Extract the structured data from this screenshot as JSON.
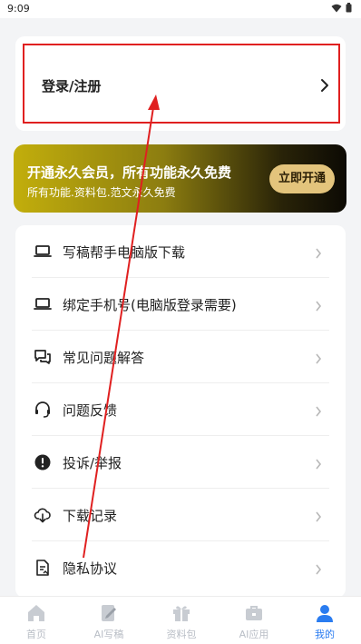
{
  "status_bar": {
    "time": "9:09",
    "icons": [
      "wifi-icon",
      "battery-icon"
    ]
  },
  "login": {
    "label": "登录/注册"
  },
  "vip": {
    "title": "开通永久会员，所有功能永久免费",
    "subtitle": "所有功能.资料包.范文永久免费",
    "button_label": "立即开通"
  },
  "menu": {
    "items": [
      {
        "label": "写稿帮手电脑版下载",
        "icon": "laptop-icon"
      },
      {
        "label": "绑定手机号(电脑版登录需要)",
        "icon": "laptop-icon"
      },
      {
        "label": "常见问题解答",
        "icon": "chat-bubbles-icon"
      },
      {
        "label": "问题反馈",
        "icon": "headset-icon"
      },
      {
        "label": "投诉/举报",
        "icon": "alert-icon"
      },
      {
        "label": "下载记录",
        "icon": "cloud-download-icon"
      },
      {
        "label": "隐私协议",
        "icon": "document-icon"
      }
    ]
  },
  "tabbar": {
    "items": [
      {
        "label": "首页",
        "icon": "home-icon",
        "active": false
      },
      {
        "label": "AI写稿",
        "icon": "pen-icon",
        "active": false
      },
      {
        "label": "资料包",
        "icon": "gift-icon",
        "active": false
      },
      {
        "label": "AI应用",
        "icon": "briefcase-icon",
        "active": false
      },
      {
        "label": "我的",
        "icon": "user-icon",
        "active": true
      }
    ]
  },
  "colors": {
    "accent": "#2a7cf0",
    "annotation": "#e02020",
    "vip_button": "#e3c47c",
    "inactive_tab": "#b9bec6"
  }
}
